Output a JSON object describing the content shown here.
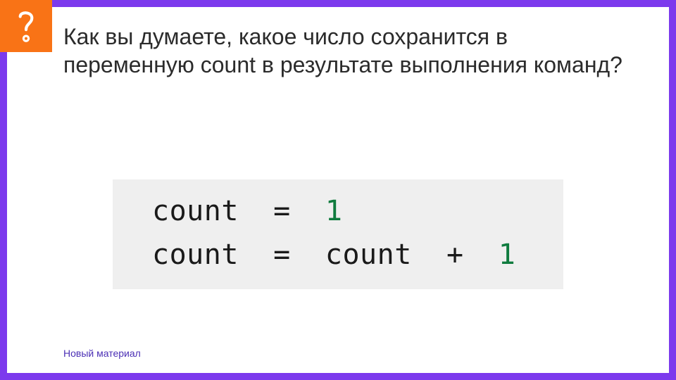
{
  "heading": "Как вы думаете, какое число сохранится в переменную count в результате выполнения команд?",
  "code": {
    "line1": {
      "var": "count",
      "eq": "=",
      "val": "1"
    },
    "line2": {
      "var": "count",
      "eq": "=",
      "rhs_var": "count",
      "plus": "+",
      "val": "1"
    }
  },
  "footer": "Новый материал"
}
